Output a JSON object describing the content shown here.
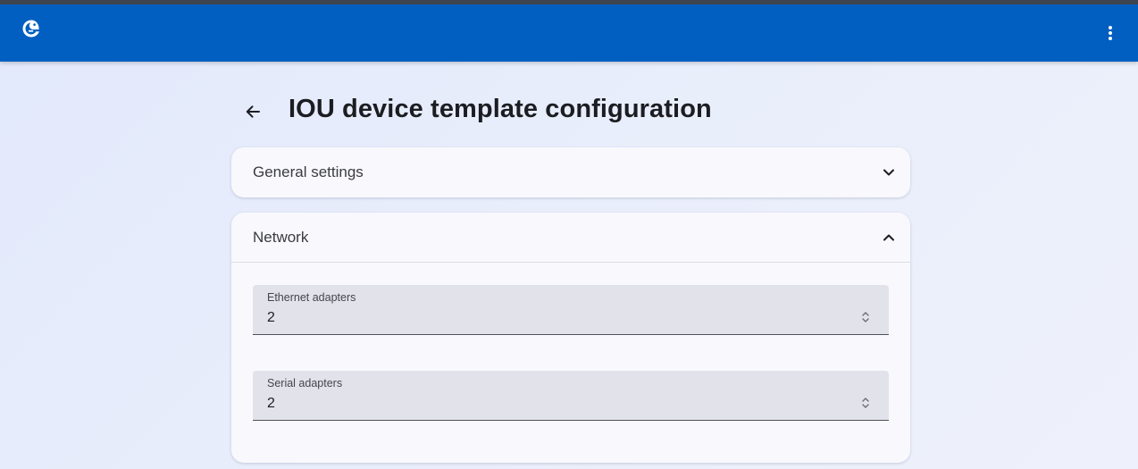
{
  "topbar": {
    "color": "#005fc0",
    "logo_icon": "gns3-logo-icon",
    "menu_icon": "more-vert-icon"
  },
  "page": {
    "title": "IOU device template configuration",
    "back_icon": "arrow-back-icon"
  },
  "panels": {
    "general": {
      "title": "General settings",
      "expanded": false,
      "icon": "chevron-down-icon"
    },
    "network": {
      "title": "Network",
      "expanded": true,
      "icon": "chevron-up-icon",
      "fields": {
        "ethernet": {
          "label": "Ethernet adapters",
          "value": "2"
        },
        "serial": {
          "label": "Serial adapters",
          "value": "2"
        }
      }
    }
  }
}
